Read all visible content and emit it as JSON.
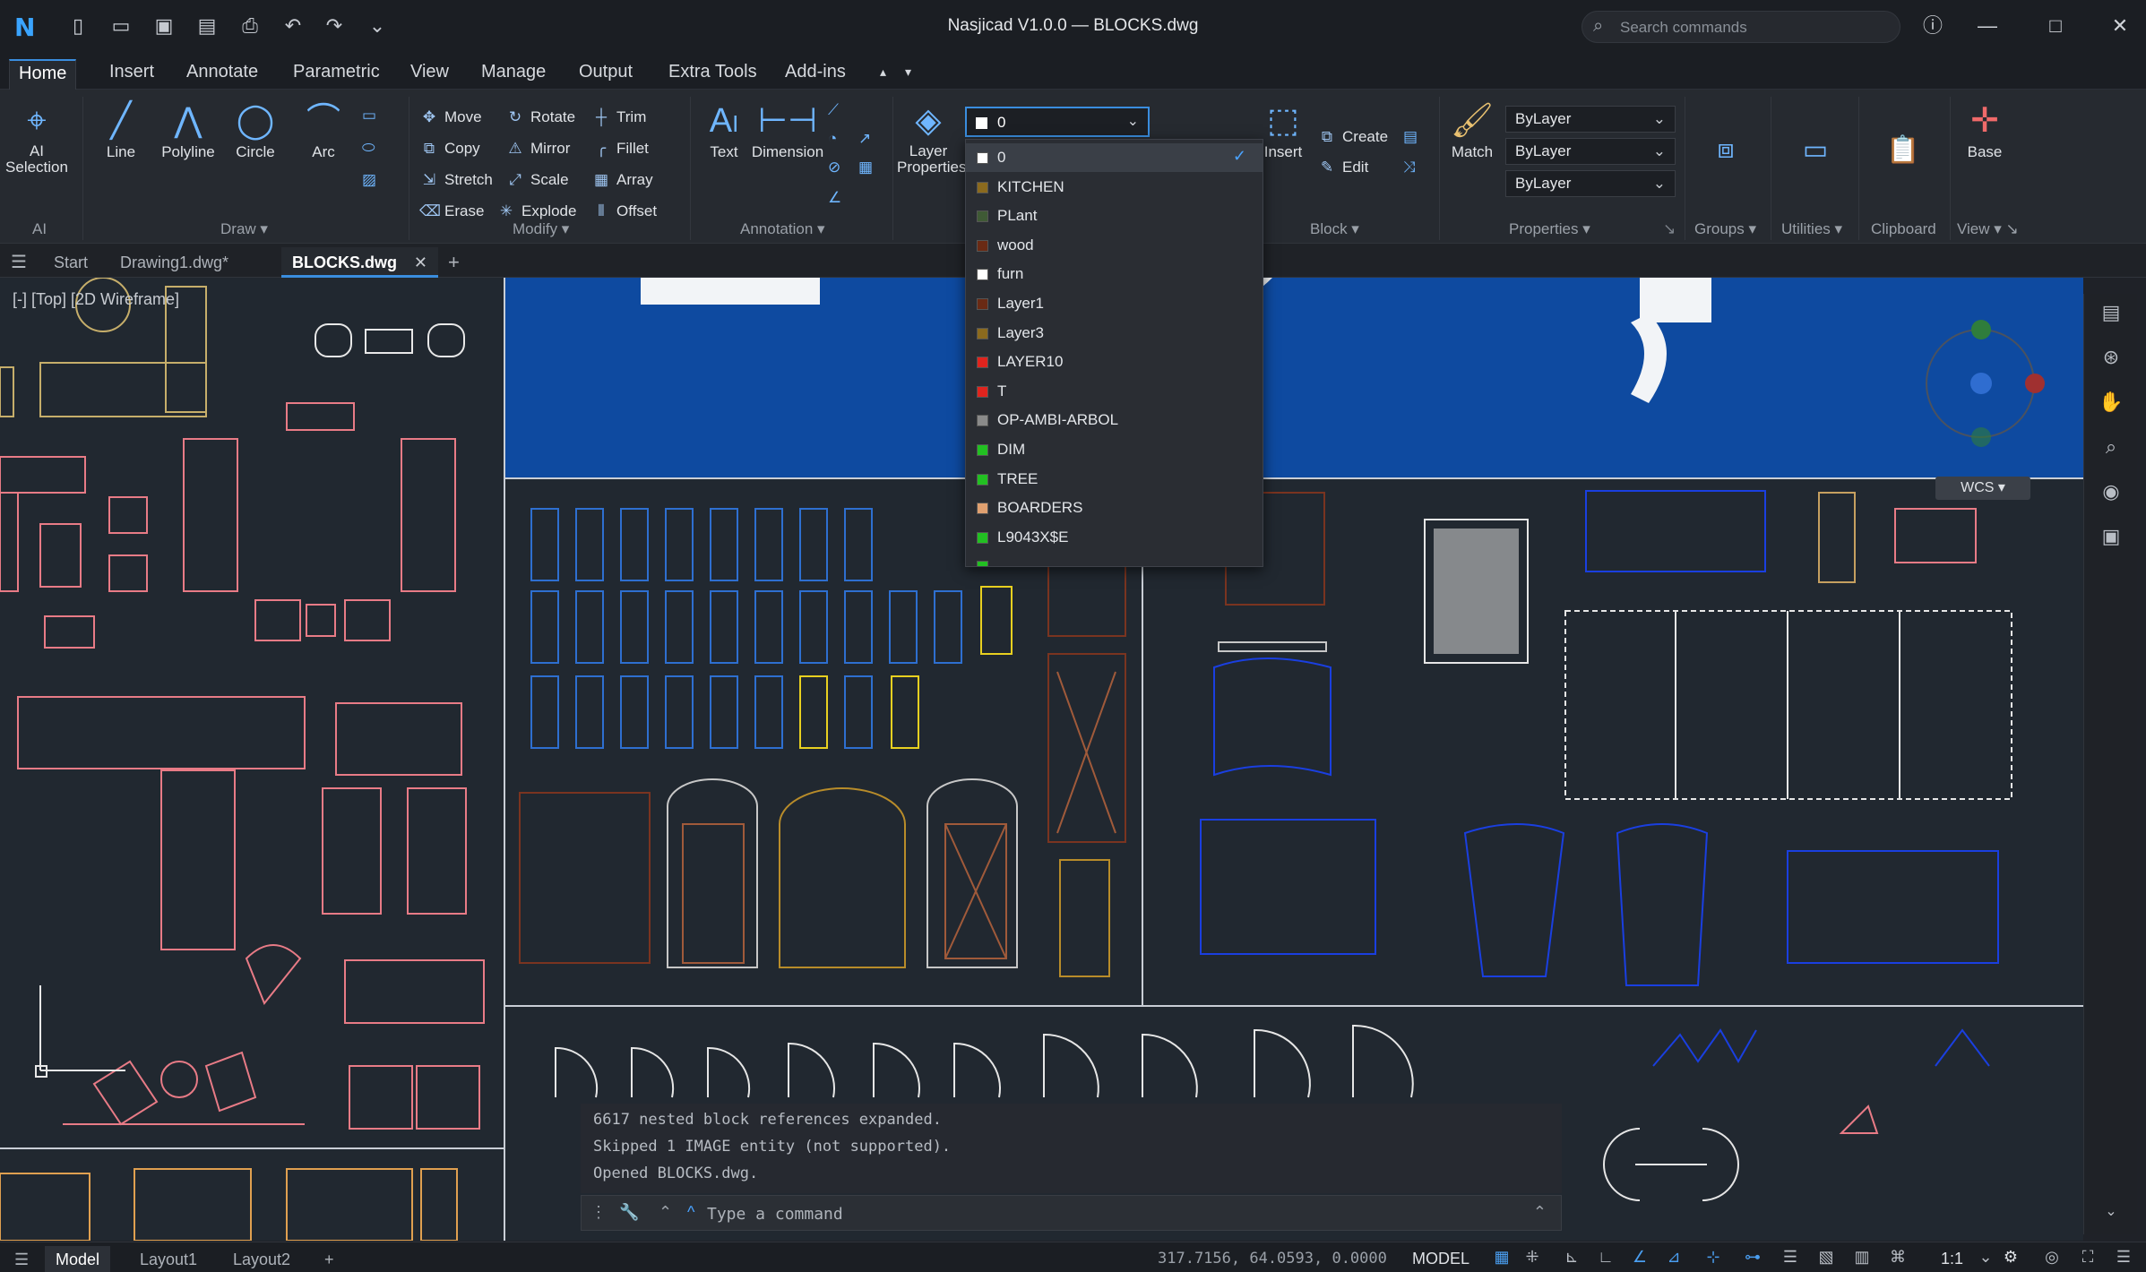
{
  "app": {
    "title": "Nasjicad V1.0.0 — BLOCKS.dwg",
    "logo_letter": "N",
    "search_placeholder": "Search commands"
  },
  "quick_access": [
    "new-file-icon",
    "open-folder-icon",
    "save-icon",
    "save-as-icon",
    "print-icon",
    "undo-icon",
    "redo-icon",
    "chevron-down-icon"
  ],
  "ribbon_tabs": [
    "Home",
    "Insert",
    "Annotate",
    "Parametric",
    "View",
    "Manage",
    "Output",
    "Extra Tools",
    "Add-ins"
  ],
  "ribbon": {
    "ai": {
      "tool": "AI Selection",
      "panel": "AI"
    },
    "draw": {
      "tools": [
        "Line",
        "Polyline",
        "Circle",
        "Arc"
      ],
      "panel": "Draw"
    },
    "modify": {
      "col1": [
        "Move",
        "Copy",
        "Stretch",
        "Erase"
      ],
      "col2": [
        "Rotate",
        "Mirror",
        "Scale",
        "Explode"
      ],
      "col3": [
        "Trim",
        "Fillet",
        "Array",
        "Offset"
      ],
      "panel": "Modify"
    },
    "annotation": {
      "tools": [
        "Text",
        "Dimension"
      ],
      "panel": "Annotation"
    },
    "layers": {
      "tool": "Layer Properties",
      "current": "0"
    },
    "block": {
      "insert": "Insert",
      "create": "Create",
      "edit": "Edit",
      "panel": "Block"
    },
    "properties": {
      "match": "Match",
      "bylayer": [
        "ByLayer",
        "ByLayer",
        "ByLayer"
      ],
      "panel": "Properties"
    },
    "groups": {
      "panel": "Groups"
    },
    "utilities": {
      "panel": "Utilities"
    },
    "clipboard": {
      "panel": "Clipboard"
    },
    "view": {
      "tool": "Base",
      "panel": "View"
    }
  },
  "layer_menu": {
    "selected": "0",
    "items": [
      {
        "name": "0",
        "color": "#ffffff"
      },
      {
        "name": "KITCHEN",
        "color": "#8b6a1e"
      },
      {
        "name": "PLant",
        "color": "#3f5a35"
      },
      {
        "name": "wood",
        "color": "#6a2a14"
      },
      {
        "name": "furn",
        "color": "#ffffff"
      },
      {
        "name": "Layer1",
        "color": "#6a2a14"
      },
      {
        "name": "Layer3",
        "color": "#8b6a1e"
      },
      {
        "name": "LAYER10",
        "color": "#e0241e"
      },
      {
        "name": "T",
        "color": "#e0241e"
      },
      {
        "name": "OP-AMBI-ARBOL",
        "color": "#8a8a8a"
      },
      {
        "name": "DIM",
        "color": "#22c022"
      },
      {
        "name": "TREE",
        "color": "#22c022"
      },
      {
        "name": "BOARDERS",
        "color": "#e0a070"
      },
      {
        "name": "L9043X$E",
        "color": "#22c022"
      },
      {
        "name": "",
        "color": "#22c022"
      }
    ]
  },
  "doc_tabs": {
    "start": "Start",
    "tabs": [
      "Drawing1.dwg*",
      "BLOCKS.dwg"
    ],
    "active": "BLOCKS.dwg"
  },
  "viewport": {
    "label": "[-] [Top] [2D Wireframe]",
    "wcs": "WCS"
  },
  "command_history": [
    "6617 nested block references expanded.",
    "Skipped 1 IMAGE entity (not supported).",
    "Opened BLOCKS.dwg."
  ],
  "command_line": {
    "placeholder": "Type a command"
  },
  "status_bar": {
    "layouts": [
      "Model",
      "Layout1",
      "Layout2"
    ],
    "active_layout": "Model",
    "coords": "317.7156, 64.0593, 0.0000",
    "mode": "MODEL",
    "scale": "1:1"
  },
  "colors": {
    "accent": "#3a8dde",
    "drawing_bg": "#212830",
    "blue_block": "#0e4aa0"
  }
}
